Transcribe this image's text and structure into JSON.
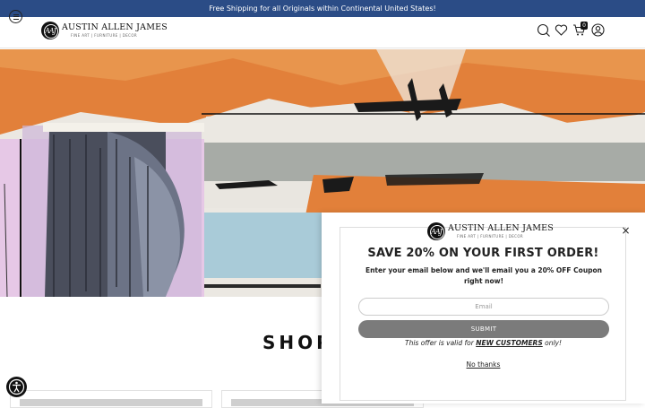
{
  "announcement": {
    "text": "Free Shipping for all Originals within Continental United States!"
  },
  "header": {
    "brand_name": "AUSTIN ALLEN JAMES",
    "brand_monogram": "AAJ",
    "brand_tagline": "FINE ART  |  FURNITURE  |  DECOR",
    "cart_count": "0",
    "icons": [
      "menu-icon",
      "search-icon",
      "heart-icon",
      "cart-icon",
      "account-icon"
    ]
  },
  "hero": {
    "image": "abstract painting with orange, grey and black brush strokes and a sculpted face"
  },
  "shop": {
    "heading": "SHOP"
  },
  "popup": {
    "brand_name": "AUSTIN ALLEN JAMES",
    "brand_tagline": "FINE ART  |  FURNITURE  |  DECOR",
    "title": "SAVE 20% ON YOUR FIRST ORDER!",
    "subtitle": "Enter your email below and we'll email you a 20% OFF Coupon right now!",
    "email_placeholder": "Email",
    "submit_label": "SUBMIT",
    "offer_prefix": "This offer is valid for ",
    "offer_highlight": "NEW CUSTOMERS",
    "offer_suffix": " only!",
    "dismiss_label": "No thanks",
    "close_symbol": "×"
  },
  "colors": {
    "announcement_bg": "#2b4c86",
    "submit_bg": "#7b7b7b",
    "hero_orange": "#e0782f"
  }
}
